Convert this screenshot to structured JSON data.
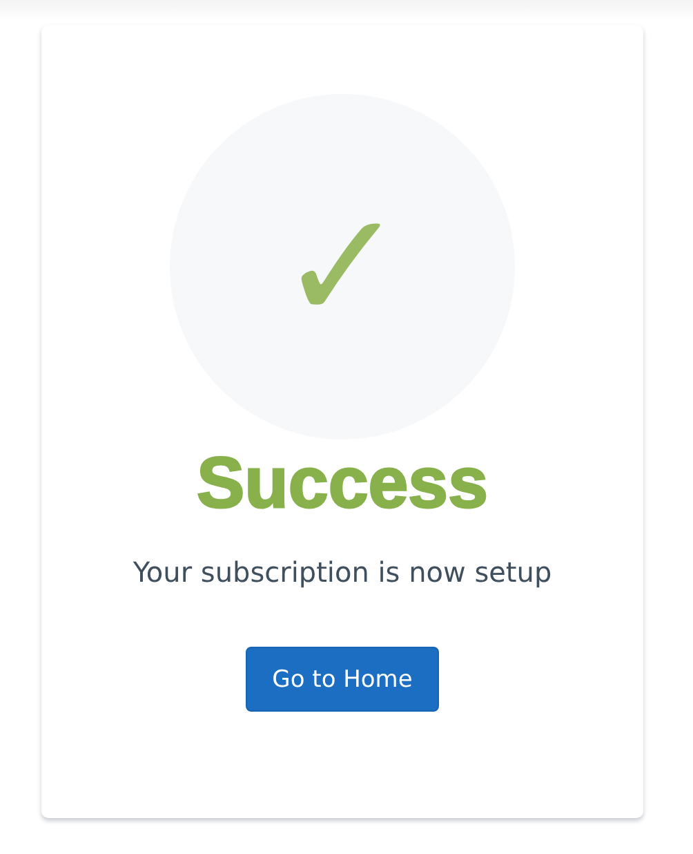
{
  "card": {
    "mark": "✓",
    "title": "Success",
    "message": "Your subscription is now setup",
    "button": "Go to Home"
  }
}
